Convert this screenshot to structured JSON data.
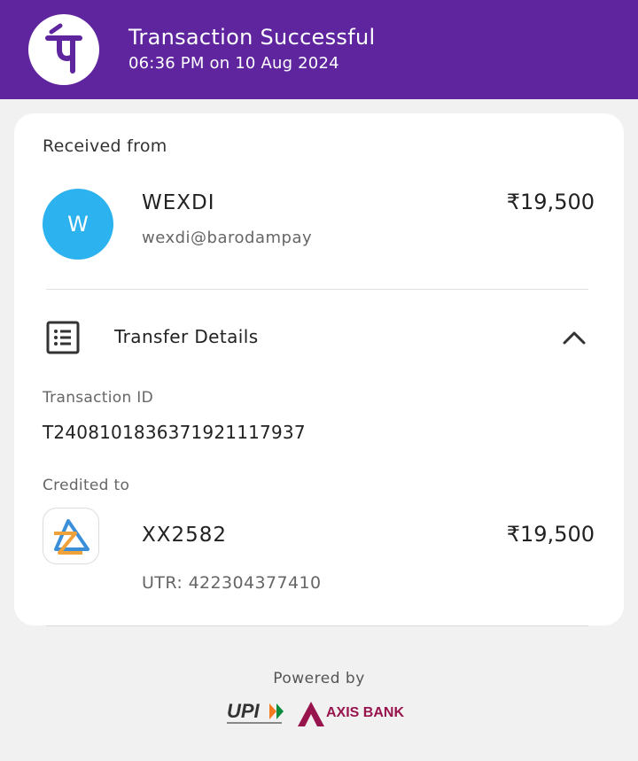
{
  "header": {
    "logo_icon": "phonepe-logo-icon",
    "title": "Transaction Successful",
    "datetime": "06:36 PM on 10 Aug 2024",
    "bg_color": "#5f259f"
  },
  "received": {
    "label": "Received from",
    "avatar_initial": "W",
    "avatar_color": "#2bb2ef",
    "name": "WEXDI",
    "vpa": "wexdi@barodampay",
    "amount": "₹19,500"
  },
  "transfer_details": {
    "icon": "list-icon",
    "label": "Transfer Details",
    "toggle_icon": "chevron-up-icon",
    "transaction_id_label": "Transaction ID",
    "transaction_id": "T2408101836371921117937",
    "credited_label": "Credited to",
    "bank_icon": "bank-of-baroda-logo-icon",
    "account": "XX2582",
    "amount": "₹19,500",
    "utr": "UTR: 422304377410"
  },
  "footer": {
    "powered_by": "Powered by",
    "upi_logo": "UPI",
    "axis_bank": "AXIS BANK"
  }
}
